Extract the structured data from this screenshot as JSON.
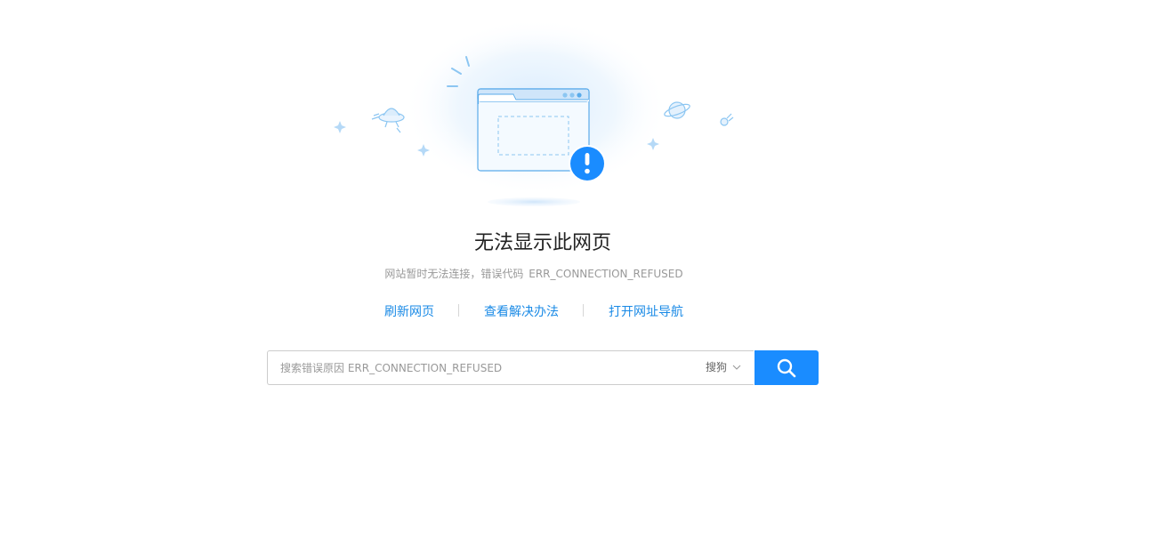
{
  "error": {
    "title": "无法显示此网页",
    "message": "网站暂时无法连接，错误代码",
    "code": "ERR_CONNECTION_REFUSED"
  },
  "actions": {
    "refresh": "刷新网页",
    "solutions": "查看解决办法",
    "navigation": "打开网址导航"
  },
  "search": {
    "placeholder": "搜索错误原因 ERR_CONNECTION_REFUSED",
    "engine": "搜狗"
  },
  "colors": {
    "accent": "#1a8cff",
    "link": "#1a8ae6",
    "illustration": "#5aabea"
  },
  "icons": {
    "search_button": "search-icon",
    "engine_dropdown": "chevron-down-icon",
    "error_badge": "exclamation-icon"
  }
}
